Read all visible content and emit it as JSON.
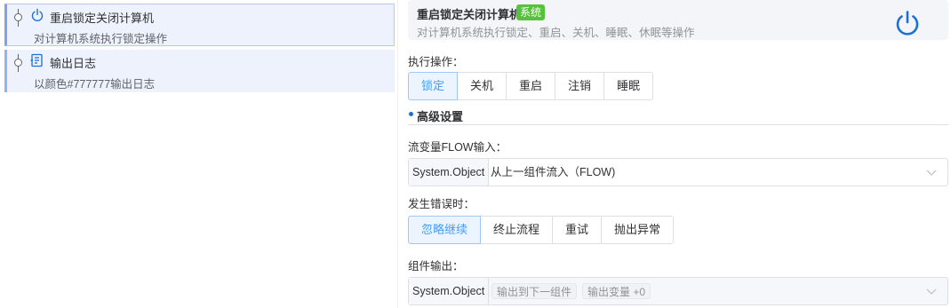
{
  "flow": {
    "steps": [
      {
        "title": "重启锁定关闭计算机",
        "desc": "对计算机系统执行锁定操作",
        "icon": "power-icon",
        "selected": true
      },
      {
        "title": "输出日志",
        "desc": "以颜色#777777输出日志",
        "icon": "log-output-icon",
        "selected": false
      }
    ]
  },
  "panel": {
    "title": "重启锁定关闭计算机",
    "badge": "系统",
    "desc": "对计算机系统执行锁定、重启、关机、睡眠、休眠等操作",
    "icon": "power-icon",
    "execute": {
      "label": "执行操作：",
      "options": [
        "锁定",
        "关机",
        "重启",
        "注销",
        "睡眠"
      ],
      "selected": "锁定"
    },
    "advanced": {
      "title": "高级设置"
    },
    "flow_input": {
      "label": "流变量FLOW输入：",
      "type": "System.Object",
      "value": "从上一组件流入（FLOW)"
    },
    "on_error": {
      "label": "发生错误时：",
      "options": [
        "忽略继续",
        "终止流程",
        "重试",
        "抛出异常"
      ],
      "selected": "忽略继续"
    },
    "output": {
      "label": "组件输出：",
      "type": "System.Object",
      "tags": [
        "输出到下一组件",
        "输出变量 +0"
      ]
    }
  },
  "colors": {
    "accent": "#409eff",
    "badge": "#56c23a",
    "power_icon": "#1b6fd8",
    "selected_step_bg": "#edf2fd"
  }
}
